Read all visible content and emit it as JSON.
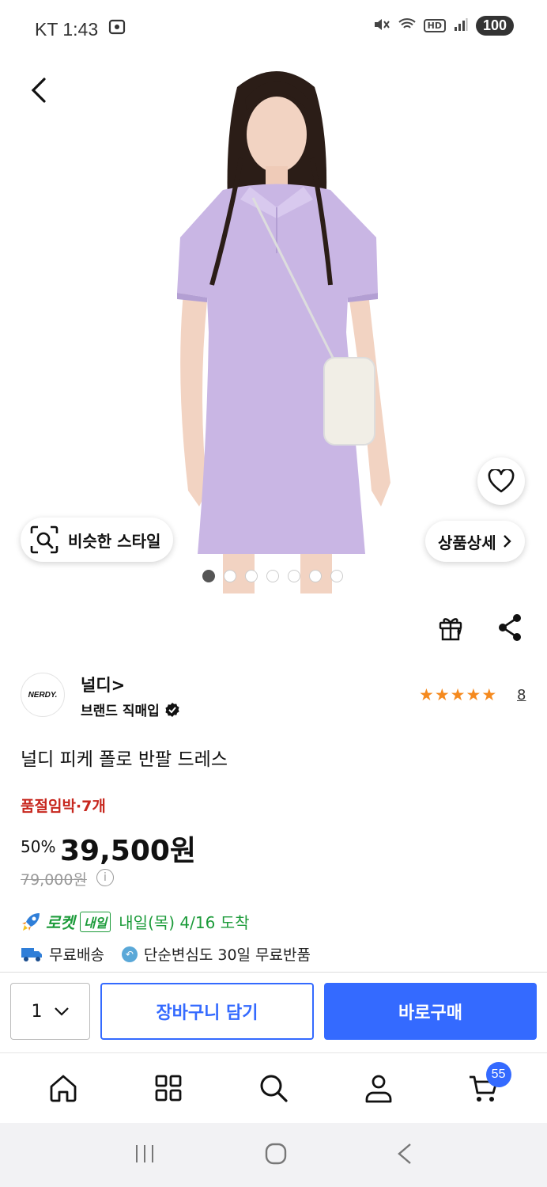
{
  "status_bar": {
    "carrier_time": "KT 1:43",
    "hd": "HD",
    "battery": "100"
  },
  "gallery": {
    "similar_style_label": "비슷한 스타일",
    "detail_label": "상품상세",
    "image_count": 7,
    "active_index": 0,
    "colors": {
      "dress": "#c9b6e4",
      "skin": "#f2d3c2",
      "hair": "#2b1d17"
    }
  },
  "brand": {
    "logo_text": "NERDY.",
    "name": "널디>",
    "subtitle": "브랜드 직매입",
    "rating": 5,
    "review_count": "8"
  },
  "product": {
    "title": "널디 피케 폴로 반팔 드레스",
    "stock_warning": "품절임박·7개",
    "discount": "50%",
    "sale_price": "39,500원",
    "original_price": "79,000원"
  },
  "delivery": {
    "rocket_label": "로켓",
    "rocket_tag": "내일",
    "arrival": "내일(목) 4/16 도착",
    "free_shipping": "무료배송",
    "returns": "단순변심도 30일 무료반품"
  },
  "purchase": {
    "quantity": "1",
    "cart_button": "장바구니 담기",
    "buy_button": "바로구매"
  },
  "bottom_nav": {
    "cart_count": "55",
    "icons": [
      "home-icon",
      "category-icon",
      "search-icon",
      "my-page-icon",
      "cart-icon"
    ]
  },
  "theme": {
    "accent": "#346aff",
    "rocket_green": "#1c9b3a",
    "warning_red": "#c7271e",
    "star": "#f58a1f"
  }
}
